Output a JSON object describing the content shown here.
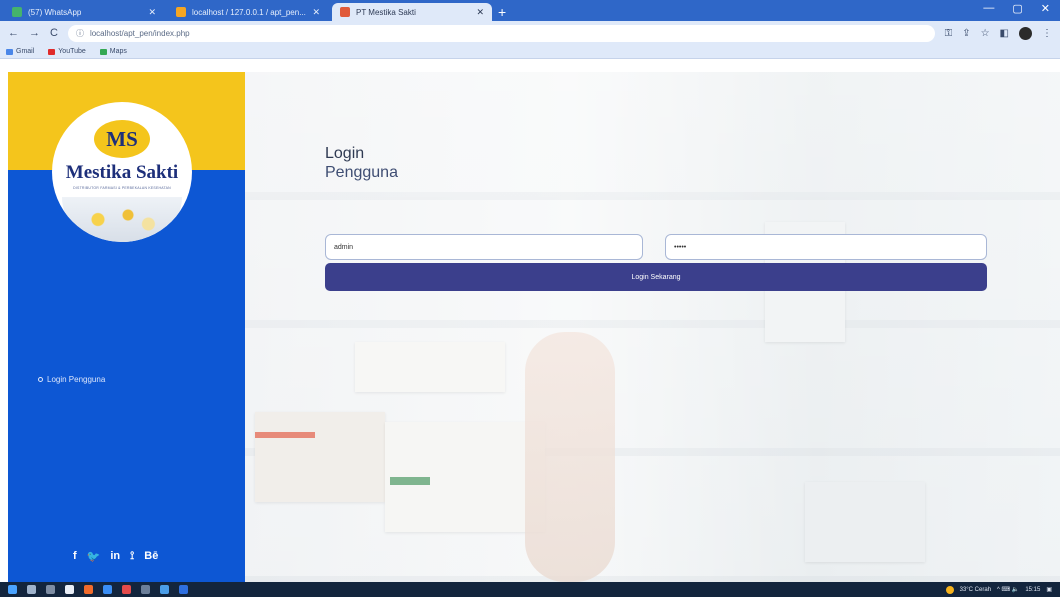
{
  "browser": {
    "tabs": [
      {
        "title": "(57) WhatsApp",
        "active": false
      },
      {
        "title": "localhost / 127.0.0.1 / apt_pen...",
        "active": false
      },
      {
        "title": "PT Mestika Sakti",
        "active": true
      }
    ],
    "new_tab": "+",
    "window_controls": [
      "—",
      "▢",
      "✕"
    ],
    "url": "localhost/apt_pen/index.php",
    "nav": {
      "back": "←",
      "forward": "→",
      "reload": "C"
    },
    "bookmarks": [
      {
        "label": "Gmail",
        "color": "#4a86e8"
      },
      {
        "label": "YouTube",
        "color": "#e02b2b"
      },
      {
        "label": "Maps",
        "color": "#34a853"
      }
    ]
  },
  "sidebar": {
    "logo": {
      "initials": "MS",
      "name": "Mestika Sakti",
      "tagline": "DISTRIBUTOR FARMASI & PERBEKALAN KESEHATAN"
    },
    "nav_item": "Login Pengguna",
    "social": [
      "f",
      "🐦",
      "in",
      "⟟",
      "Bē"
    ]
  },
  "main": {
    "title_line1": "Login",
    "title_line2": "Pengguna",
    "username_value": "admin",
    "password_value": "•••••",
    "login_button": "Login Sekarang"
  },
  "taskbar": {
    "weather": "33°C Cerah",
    "time": "15:15"
  },
  "colors": {
    "sidebar_blue": "#0d57d4",
    "sidebar_yellow": "#f4c51c",
    "button": "#3b3f8c"
  }
}
